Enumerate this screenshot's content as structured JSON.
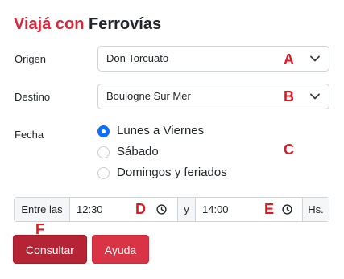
{
  "header": {
    "title_accent": "Viajá con",
    "title_brand": "Ferrovías"
  },
  "form": {
    "origin": {
      "label": "Origen",
      "value": "Don Torcuato",
      "marker": "A"
    },
    "destination": {
      "label": "Destino",
      "value": "Boulogne Sur Mer",
      "marker": "B"
    },
    "date": {
      "label": "Fecha",
      "marker": "C",
      "options": [
        {
          "label": "Lunes a Viernes",
          "checked": true
        },
        {
          "label": "Sábado",
          "checked": false
        },
        {
          "label": "Domingos y feriados",
          "checked": false
        }
      ]
    },
    "time_range": {
      "prefix": "Entre las",
      "from_value": "12:30",
      "from_marker": "D",
      "connector": "y",
      "to_value": "14:00",
      "to_marker": "E",
      "suffix": "Hs."
    }
  },
  "actions": {
    "submit_label": "Consultar",
    "submit_marker": "F",
    "help_label": "Ayuda"
  },
  "colors": {
    "accent": "#d9263a",
    "primary_button": "#b52435",
    "secondary_button": "#d93446",
    "radio_checked": "#0d6efd",
    "marker": "#e2171c"
  },
  "icons": {
    "select_chevron": "chevron-down-icon",
    "time_icon": "clock-icon"
  }
}
